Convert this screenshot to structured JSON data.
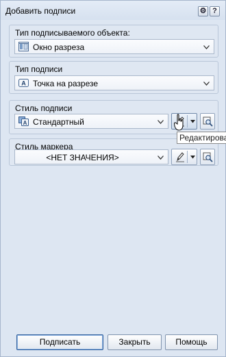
{
  "window": {
    "title": "Добавить подписи",
    "settings_icon_glyph": "⚙",
    "help_icon_glyph": "?"
  },
  "groups": {
    "object_type": {
      "label": "Тип подписываемого объекта:",
      "value": "Окно разреза",
      "icon": "section-window-icon"
    },
    "label_type": {
      "label": "Тип подписи",
      "value": "Точка на разрезе",
      "icon": "point-label-icon"
    },
    "label_style": {
      "label": "Стиль подписи",
      "value": "Стандартный",
      "icon": "label-style-icon"
    },
    "marker_style": {
      "label": "Стиль маркера",
      "value": "<НЕТ ЗНАЧЕНИЯ>"
    }
  },
  "tooltip": {
    "text": "Редактирова"
  },
  "buttons": {
    "sign": "Подписать",
    "close": "Закрыть",
    "help": "Помощь"
  },
  "colors": {
    "window_bg": "#dde6f2",
    "group_border": "#b9c6d8",
    "default_button_border": "#2e5d9a"
  }
}
